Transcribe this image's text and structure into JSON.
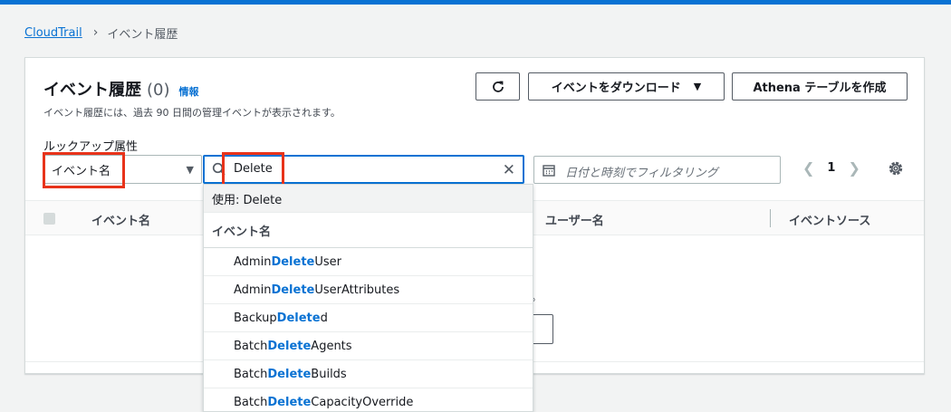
{
  "breadcrumb": {
    "root": "CloudTrail",
    "current": "イベント履歴"
  },
  "header": {
    "title": "イベント履歴",
    "count": "(0)",
    "info_link": "情報",
    "description": "イベント履歴には、過去 90 日間の管理イベントが表示されます。"
  },
  "buttons": {
    "download_label": "イベントをダウンロード",
    "athena_label": "Athena テーブルを作成"
  },
  "filter": {
    "attribute_label": "ルックアップ属性",
    "attribute_value": "イベント名",
    "search_value": "Delete",
    "date_placeholder": "日付と時刻でフィルタリング"
  },
  "pagination": {
    "current_page": "1"
  },
  "table": {
    "columns": {
      "event_name": "イベント名",
      "user_name": "ユーザー名",
      "event_source": "イベントソース"
    },
    "partial_text": "。"
  },
  "dropdown": {
    "use_option": "使用: Delete",
    "group_label": "イベント名",
    "items": [
      {
        "pre": "Admin",
        "match": "Delete",
        "post": "User"
      },
      {
        "pre": "Admin",
        "match": "Delete",
        "post": "UserAttributes"
      },
      {
        "pre": "Backup",
        "match": "Delete",
        "post": "d"
      },
      {
        "pre": "Batch",
        "match": "Delete",
        "post": "Agents"
      },
      {
        "pre": "Batch",
        "match": "Delete",
        "post": "Builds"
      },
      {
        "pre": "Batch",
        "match": "Delete",
        "post": "CapacityOverride"
      }
    ]
  },
  "colors": {
    "accent": "#0972d3",
    "highlight": "#e8331a"
  }
}
